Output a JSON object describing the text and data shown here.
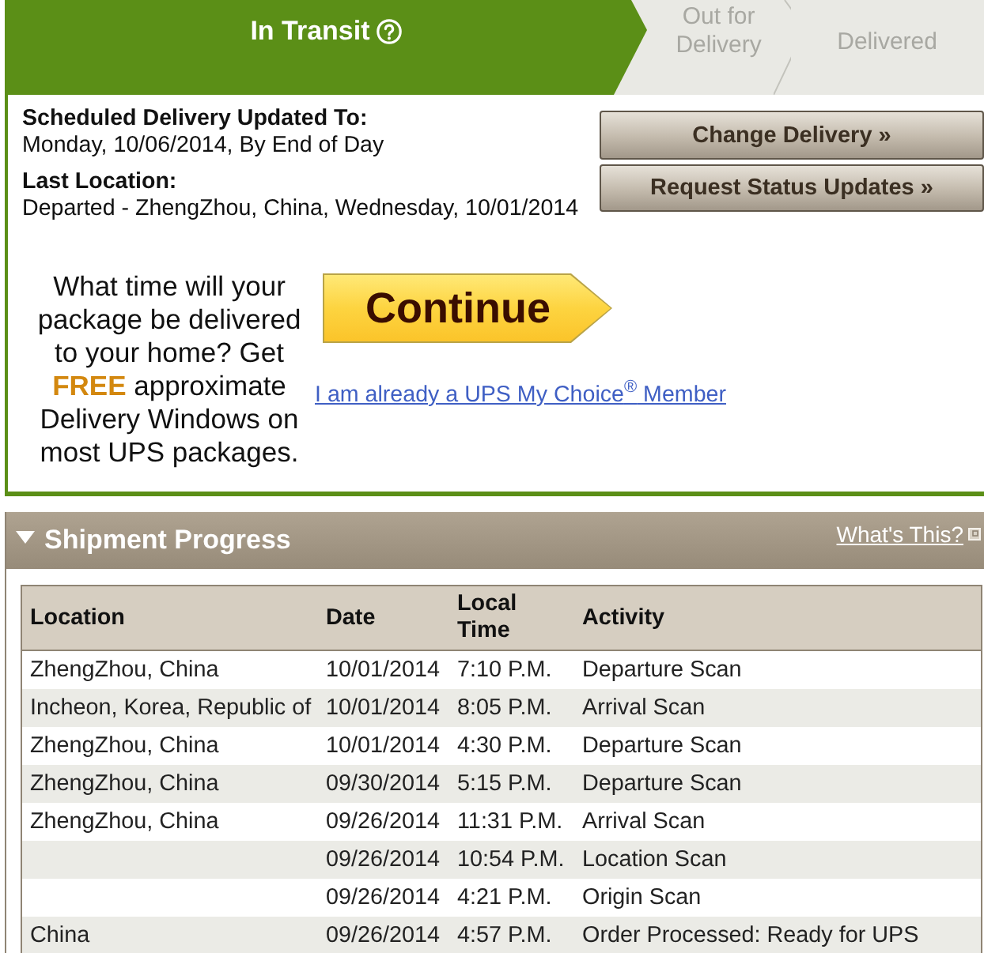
{
  "progress_steps": [
    {
      "label": "In Transit",
      "selected": true
    },
    {
      "label": "Out for Delivery",
      "selected": false
    },
    {
      "label": "Delivered",
      "selected": false
    }
  ],
  "delivery_details": [
    {
      "label": "Scheduled Delivery Updated To:",
      "value": "Monday, 10/06/2014, By End of Day"
    },
    {
      "label": "Last Location:",
      "value": "Departed - ZhengZhou, China, Wednesday, 10/01/2014"
    }
  ],
  "actions": [
    "Change Delivery »",
    "Request Status Updates »"
  ],
  "promo": {
    "text": "What time will your package be delivered to your home? Get **FREE** approximate Delivery Windows on most UPS packages.",
    "button": "Continue",
    "member_link": "I am already a UPS My Choice$^{®}$ Member"
  },
  "shipment_progress": {
    "title": "Shipment Progress",
    "expanded": true,
    "help_link": "What's This?",
    "columns": [
      "Location",
      "Date",
      "Local Time",
      "Activity"
    ],
    "rows": [
      {
        "location": "ZhengZhou, China",
        "date": "10/01/2014",
        "local_time": "7:10 P.M.",
        "activity": "Departure Scan"
      },
      {
        "location": "Incheon, Korea, Republic of",
        "date": "10/01/2014",
        "local_time": "8:05 P.M.",
        "activity": "Arrival Scan"
      },
      {
        "location": "ZhengZhou, China",
        "date": "10/01/2014",
        "local_time": "4:30 P.M.",
        "activity": "Departure Scan"
      },
      {
        "location": "ZhengZhou, China",
        "date": "09/30/2014",
        "local_time": "5:15 P.M.",
        "activity": "Departure Scan"
      },
      {
        "location": "ZhengZhou, China",
        "date": "09/26/2014",
        "local_time": "11:31 P.M.",
        "activity": "Arrival Scan"
      },
      {
        "date": "09/26/2014",
        "local_time": "10:54 P.M.",
        "activity": "Location Scan"
      },
      {
        "date": "09/26/2014",
        "local_time": "4:21 P.M.",
        "activity": "Origin Scan"
      },
      {
        "location": "China",
        "date": "09/26/2014",
        "local_time": "4:57 P.M.",
        "activity": "Order Processed: Ready for UPS"
      }
    ]
  }
}
